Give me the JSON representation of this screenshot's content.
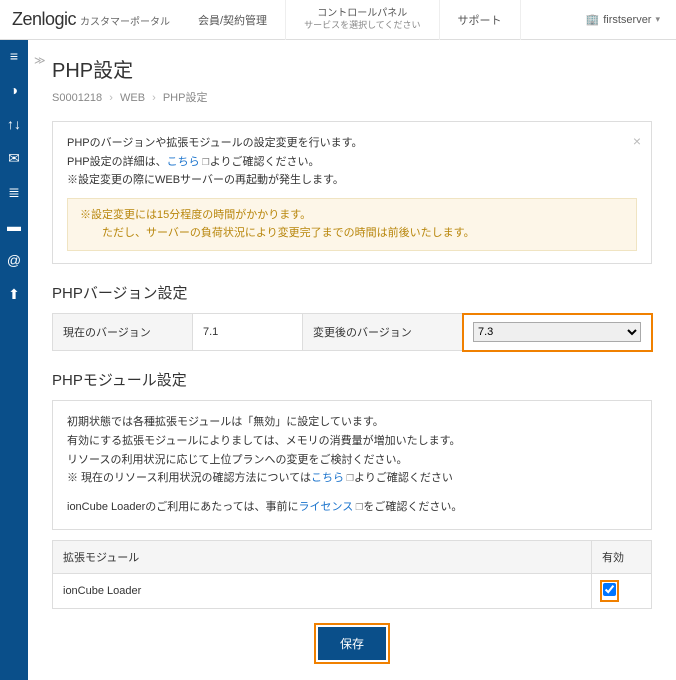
{
  "header": {
    "logo": "Zenlogic",
    "logo_sub": "カスタマーポータル",
    "nav": {
      "kaiin": "会員/契約管理",
      "cp_line1": "コントロールパネル",
      "cp_line2": "サービスを選択してください",
      "support": "サポート"
    },
    "user": "firstserver"
  },
  "page": {
    "title": "PHP設定",
    "breadcrumb": {
      "a": "S0001218",
      "b": "WEB",
      "c": "PHP設定"
    }
  },
  "info": {
    "line1": "PHPのバージョンや拡張モジュールの設定変更を行います。",
    "line2a": "PHP設定の詳細は、",
    "line2_link": "こちら",
    "line2b": "よりご確認ください。",
    "line3": "※設定変更の際にWEBサーバーの再起動が発生します。",
    "notice1": "※設定変更には15分程度の時間がかかります。",
    "notice2": "ただし、サーバーの負荷状況により変更完了までの時間は前後いたします。"
  },
  "version_section": {
    "title": "PHPバージョン設定",
    "current_label": "現在のバージョン",
    "current_value": "7.1",
    "after_label": "変更後のバージョン",
    "after_value": "7.3"
  },
  "module_section": {
    "title": "PHPモジュール設定",
    "info1": "初期状態では各種拡張モジュールは「無効」に設定しています。",
    "info2": "有効にする拡張モジュールによりましては、メモリの消費量が増加いたします。",
    "info3": "リソースの利用状況に応じて上位プランへの変更をご検討ください。",
    "info4a": "※ 現在のリソース利用状況の確認方法については",
    "info4_link": "こちら",
    "info4b": "よりご確認ください",
    "info5a": "ionCube Loaderのご利用にあたっては、事前に",
    "info5_link": "ライセンス",
    "info5b": "をご確認ください。",
    "col_module": "拡張モジュール",
    "col_enable": "有効",
    "row1_name": "ionCube Loader"
  },
  "save_label": "保存"
}
